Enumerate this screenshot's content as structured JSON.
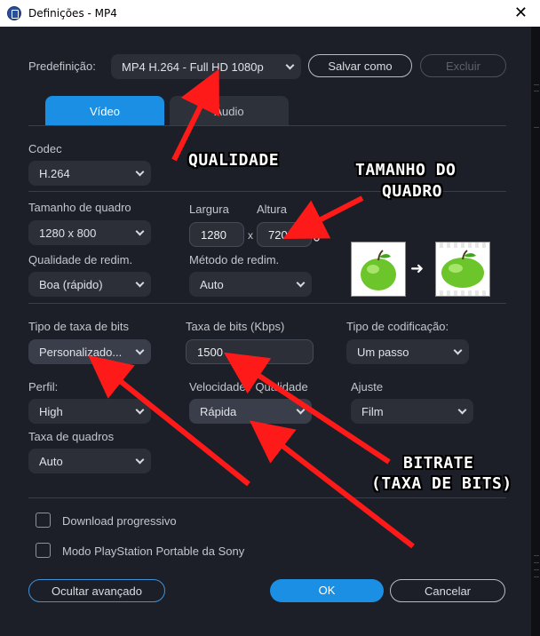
{
  "window": {
    "title": "Definições - MP4",
    "close_glyph": "✕"
  },
  "preset": {
    "label": "Predefinição:",
    "value": "MP4 H.264 - Full HD 1080p",
    "save_label": "Salvar como",
    "delete_label": "Excluir"
  },
  "tabs": [
    {
      "label": "Vídeo",
      "active": true
    },
    {
      "label": "Áudio",
      "active": false
    }
  ],
  "video": {
    "codec_label": "Codec",
    "codec_value": "H.264",
    "frame_size_label": "Tamanho de quadro",
    "frame_size_value": "1280 x 800",
    "width_label": "Largura",
    "width_value": "1280",
    "times_glyph": "x",
    "height_label": "Altura",
    "height_value": "720",
    "resize_quality_label": "Qualidade de redim.",
    "resize_quality_value": "Boa (rápido)",
    "resize_method_label": "Método de redim.",
    "resize_method_value": "Auto",
    "arrow_glyph": "➜",
    "bitrate_type_label": "Tipo de taxa de bits",
    "bitrate_type_value": "Personalizado...",
    "bitrate_label": "Taxa de bits (Kbps)",
    "bitrate_value": "1500",
    "encoding_type_label": "Tipo de codificação:",
    "encoding_type_value": "Um passo",
    "profile_label": "Perfil:",
    "profile_value": "High",
    "speed_quality_label": "Velocidade / Qualidade",
    "speed_quality_value": "Rápida",
    "fit_label": "Ajuste",
    "fit_value": "Film",
    "framerate_label": "Taxa de quadros",
    "framerate_value": "Auto"
  },
  "options": {
    "progressive_download_label": "Download progressivo",
    "progressive_download_checked": false,
    "psp_label": "Modo PlayStation Portable da Sony",
    "psp_checked": false
  },
  "footer": {
    "hide_advanced_label": "Ocultar avançado",
    "ok_label": "OK",
    "cancel_label": "Cancelar"
  },
  "annotations": {
    "quality": "QUALIDADE",
    "frame_size_line1": "TAMANHO DO",
    "frame_size_line2": "QUADRO",
    "bitrate_line1": "BITRATE",
    "bitrate_line2": "(TAXA DE BITS)",
    "arrow_color": "#ff1a1a"
  },
  "colors": {
    "accent": "#1a8fe3",
    "background": "#1c1f27"
  },
  "icons": {
    "link": "chain-link-icon",
    "apple": "green-apple-image"
  }
}
